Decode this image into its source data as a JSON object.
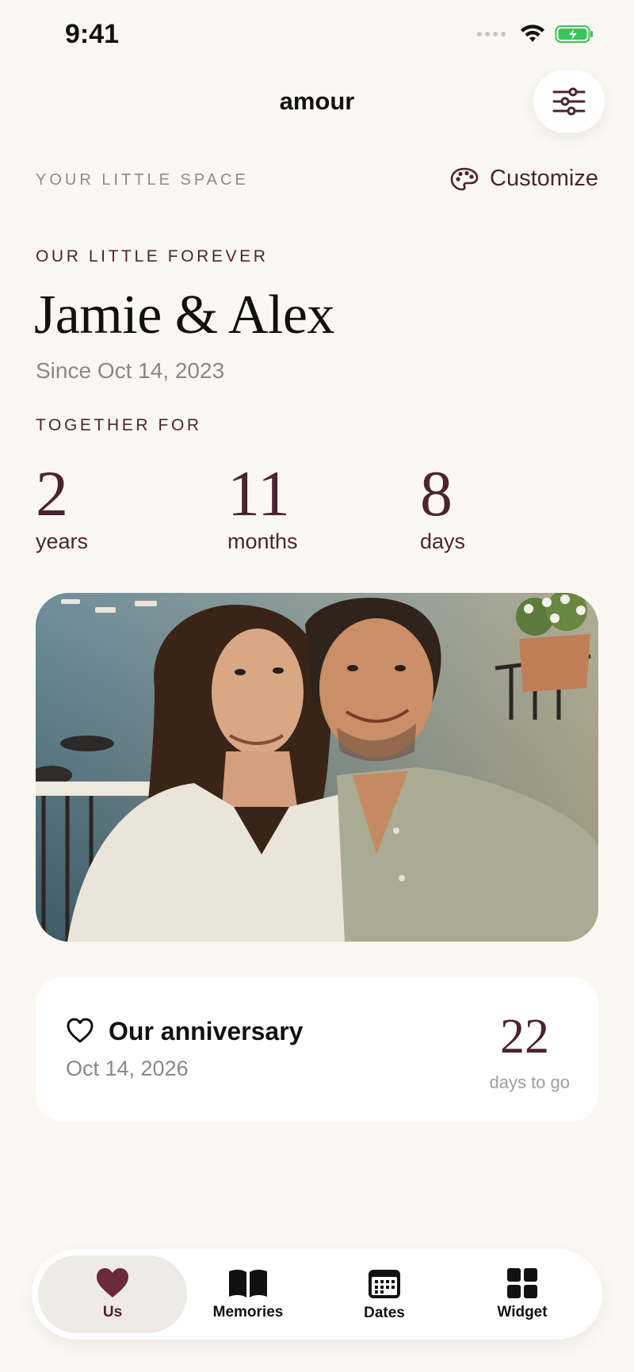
{
  "status_bar": {
    "time": "9:41"
  },
  "header": {
    "title": "amour"
  },
  "space": {
    "section_label": "YOUR LITTLE SPACE",
    "customize_label": "Customize"
  },
  "couple": {
    "eyebrow": "OUR LITTLE FOREVER",
    "names": "Jamie & Alex",
    "since": "Since Oct 14, 2023"
  },
  "together": {
    "label": "TOGETHER FOR",
    "counters": [
      {
        "value": "2",
        "unit": "years"
      },
      {
        "value": "11",
        "unit": "months"
      },
      {
        "value": "8",
        "unit": "days"
      }
    ]
  },
  "anniversary": {
    "title": "Our anniversary",
    "date": "Oct 14, 2026",
    "count": "22",
    "count_label": "days to go"
  },
  "tabs": [
    {
      "label": "Us",
      "icon": "heart-icon",
      "active": true
    },
    {
      "label": "Memories",
      "icon": "book-icon",
      "active": false
    },
    {
      "label": "Dates",
      "icon": "calendar-icon",
      "active": false
    },
    {
      "label": "Widget",
      "icon": "grid-icon",
      "active": false
    }
  ],
  "colors": {
    "background": "#fbf8f3",
    "accent": "#4c2331",
    "muted": "#8b8784",
    "battery": "#34c759"
  }
}
